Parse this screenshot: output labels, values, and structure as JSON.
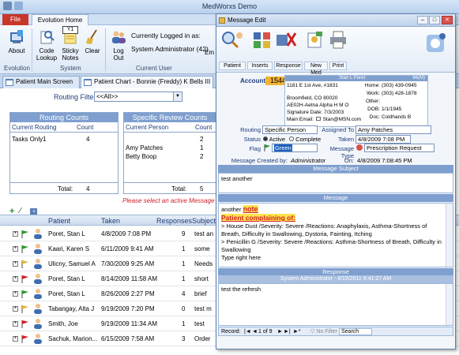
{
  "app": {
    "title": "MedWorxs Demo",
    "file_tab": "File",
    "active_ribbon_tab": "Evolution Home",
    "key_tip": "Y1"
  },
  "ribbon": {
    "groups": [
      {
        "label": "Evolution",
        "buttons": [
          {
            "label": "About",
            "icon": "about-icon"
          }
        ]
      },
      {
        "label": "System",
        "buttons": [
          {
            "label": "Code Lookup",
            "icon": "code-lookup-icon"
          },
          {
            "label": "Sticky Notes",
            "icon": "sticky-notes-icon"
          },
          {
            "label": "Clear",
            "icon": "broom-icon"
          }
        ]
      },
      {
        "label": "Current User",
        "buttons": [
          {
            "label": "Log Out",
            "icon": "users-icon"
          }
        ]
      }
    ],
    "logged_in_label": "Currently Logged in as:",
    "logged_in_user": "System Administrator (42)",
    "overflow_label": "Em"
  },
  "doc_tabs": [
    {
      "label": "Patient Main Screen",
      "active": false
    },
    {
      "label": "Patient Chart - Bonnie (Freddy) K Bells III",
      "active": true
    }
  ],
  "routing_filter": {
    "label": "Routing Filter:",
    "value": "<<All>>"
  },
  "routing_counts": {
    "title": "Routing Counts",
    "col_routing": "Current Routing",
    "col_count": "Count",
    "rows": [
      {
        "name": "Tasks Only1",
        "count": "4"
      }
    ],
    "total_label": "Total:",
    "total": "4"
  },
  "specific_review": {
    "title": "Specific Review Counts",
    "col_person": "Current Person",
    "col_count": "Count",
    "rows": [
      {
        "name": "",
        "count": "2"
      },
      {
        "name": "Amy Patches",
        "count": "1"
      },
      {
        "name": "Betty Boop",
        "count": "2"
      }
    ],
    "total_label": "Total:",
    "total": "5"
  },
  "select_message": "Please select an active Message",
  "message_list": {
    "headers": {
      "patient": "Patient",
      "taken": "Taken",
      "responses": "Responses",
      "subject": "Subject"
    },
    "rows": [
      {
        "patient": "Poret, Stan L",
        "taken": "4/8/2009 7:08 PM",
        "responses": "9",
        "subject": "test an",
        "flag": "green"
      },
      {
        "patient": "Kaari, Karen S",
        "taken": "6/11/2009 9:41 AM",
        "responses": "1",
        "subject": "some",
        "flag": "green"
      },
      {
        "patient": "Ulicny, Samuel A",
        "taken": "7/30/2009 9:25 AM",
        "responses": "1",
        "subject": "Needs",
        "flag": "yellow"
      },
      {
        "patient": "Poret, Stan L",
        "taken": "8/14/2009 11:58 AM",
        "responses": "1",
        "subject": "short",
        "flag": "red"
      },
      {
        "patient": "Poret, Stan L",
        "taken": "8/26/2009 2:27 PM",
        "responses": "4",
        "subject": "brief",
        "flag": "green"
      },
      {
        "patient": "Tabangay, Alta J",
        "taken": "9/19/2009 7:20 PM",
        "responses": "0",
        "subject": "test m",
        "flag": "yellow"
      },
      {
        "patient": "Smith, Joe",
        "taken": "9/19/2009 11:34 AM",
        "responses": "1",
        "subject": "test",
        "flag": "red"
      },
      {
        "patient": "Sachuk, Marion...",
        "taken": "6/15/2009 7:58 AM",
        "responses": "3",
        "subject": "Order",
        "flag": "red"
      }
    ]
  },
  "dialog": {
    "title": "Message Edit",
    "toolbar": [
      {
        "label": "Patient",
        "icon": "patient-search-icon"
      },
      {
        "label": "Inserts",
        "icon": "inserts-icon"
      },
      {
        "label": "Response",
        "icon": "response-icon"
      },
      {
        "label": "New Med",
        "icon": "new-med-icon"
      },
      {
        "label": "Print",
        "icon": "printer-icon"
      }
    ],
    "account": {
      "label": "Account:",
      "value": "15448"
    },
    "patient": {
      "name": "Stan L Poret",
      "age": "66(M)",
      "address1": "1181 E 1st Ave, #1831",
      "address2": "Broomfield, CO 80020",
      "insurance": "AE02H-Aetna Alpha H M O",
      "signature": "Signature Date: 7/3/2003",
      "email_label": "Main Email:",
      "email": "Stan@MSN.com",
      "home_label": "Home:",
      "home": "(303) 439-0945",
      "work_label": "Work:",
      "work": "(303) 428-1878",
      "other_label": "Other:",
      "other": "",
      "dob_label": "DOB:",
      "dob": "1/1/1945",
      "doc_label": "Doc:",
      "doc": "Coldhands B"
    },
    "routing": {
      "label": "Routing",
      "value": "Specific Person"
    },
    "assigned": {
      "label": "Assigned To",
      "value": "Amy Patches"
    },
    "status": {
      "label": "Status",
      "options": [
        "Active",
        "Complete"
      ],
      "selected": "Active"
    },
    "taken": {
      "label": "Taken",
      "value": "4/8/2009 7:08 PM"
    },
    "flag": {
      "label": "Flag",
      "value": "Green"
    },
    "message_type": {
      "label": "Message Type",
      "value": "Prescription Request"
    },
    "created_by": {
      "label": "Message Created by:",
      "value": "Administrator"
    },
    "created_on": {
      "label": "On:",
      "value": "4/8/2009 7:08:45 PM"
    },
    "subject_title": "Message Subject",
    "subject": "test another",
    "message_title": "Message",
    "message": {
      "line1_prefix": "another ",
      "line1_highlight": "note",
      "heading": "Patient complaining of:",
      "allergy1": "> House Dust  /Severity: Severe /Reactions: Anaphylaxis, Asthma-Shortness of Breath, Difficulty in Swallowing, Dystoria, Fainting, Itching",
      "allergy2": "> Penicillin G /Severity: Severe /Reactions: Asthma-Shortness of Breath, Difficulty in Swallowing",
      "tail": "Type right here"
    },
    "response_title": "Response",
    "response_header": "System Administrator - 4/15/2011 8:41:27 AM",
    "response_text": "test the refresh",
    "record_nav": {
      "label": "Record:",
      "position": "1 of 9",
      "filter": "No Filter",
      "search": "Search"
    }
  },
  "colors": {
    "accent": "#7f9fcf",
    "file_tab": "#c8362a",
    "account_highlight": "#f2b233",
    "alert_red": "#d0202a"
  }
}
